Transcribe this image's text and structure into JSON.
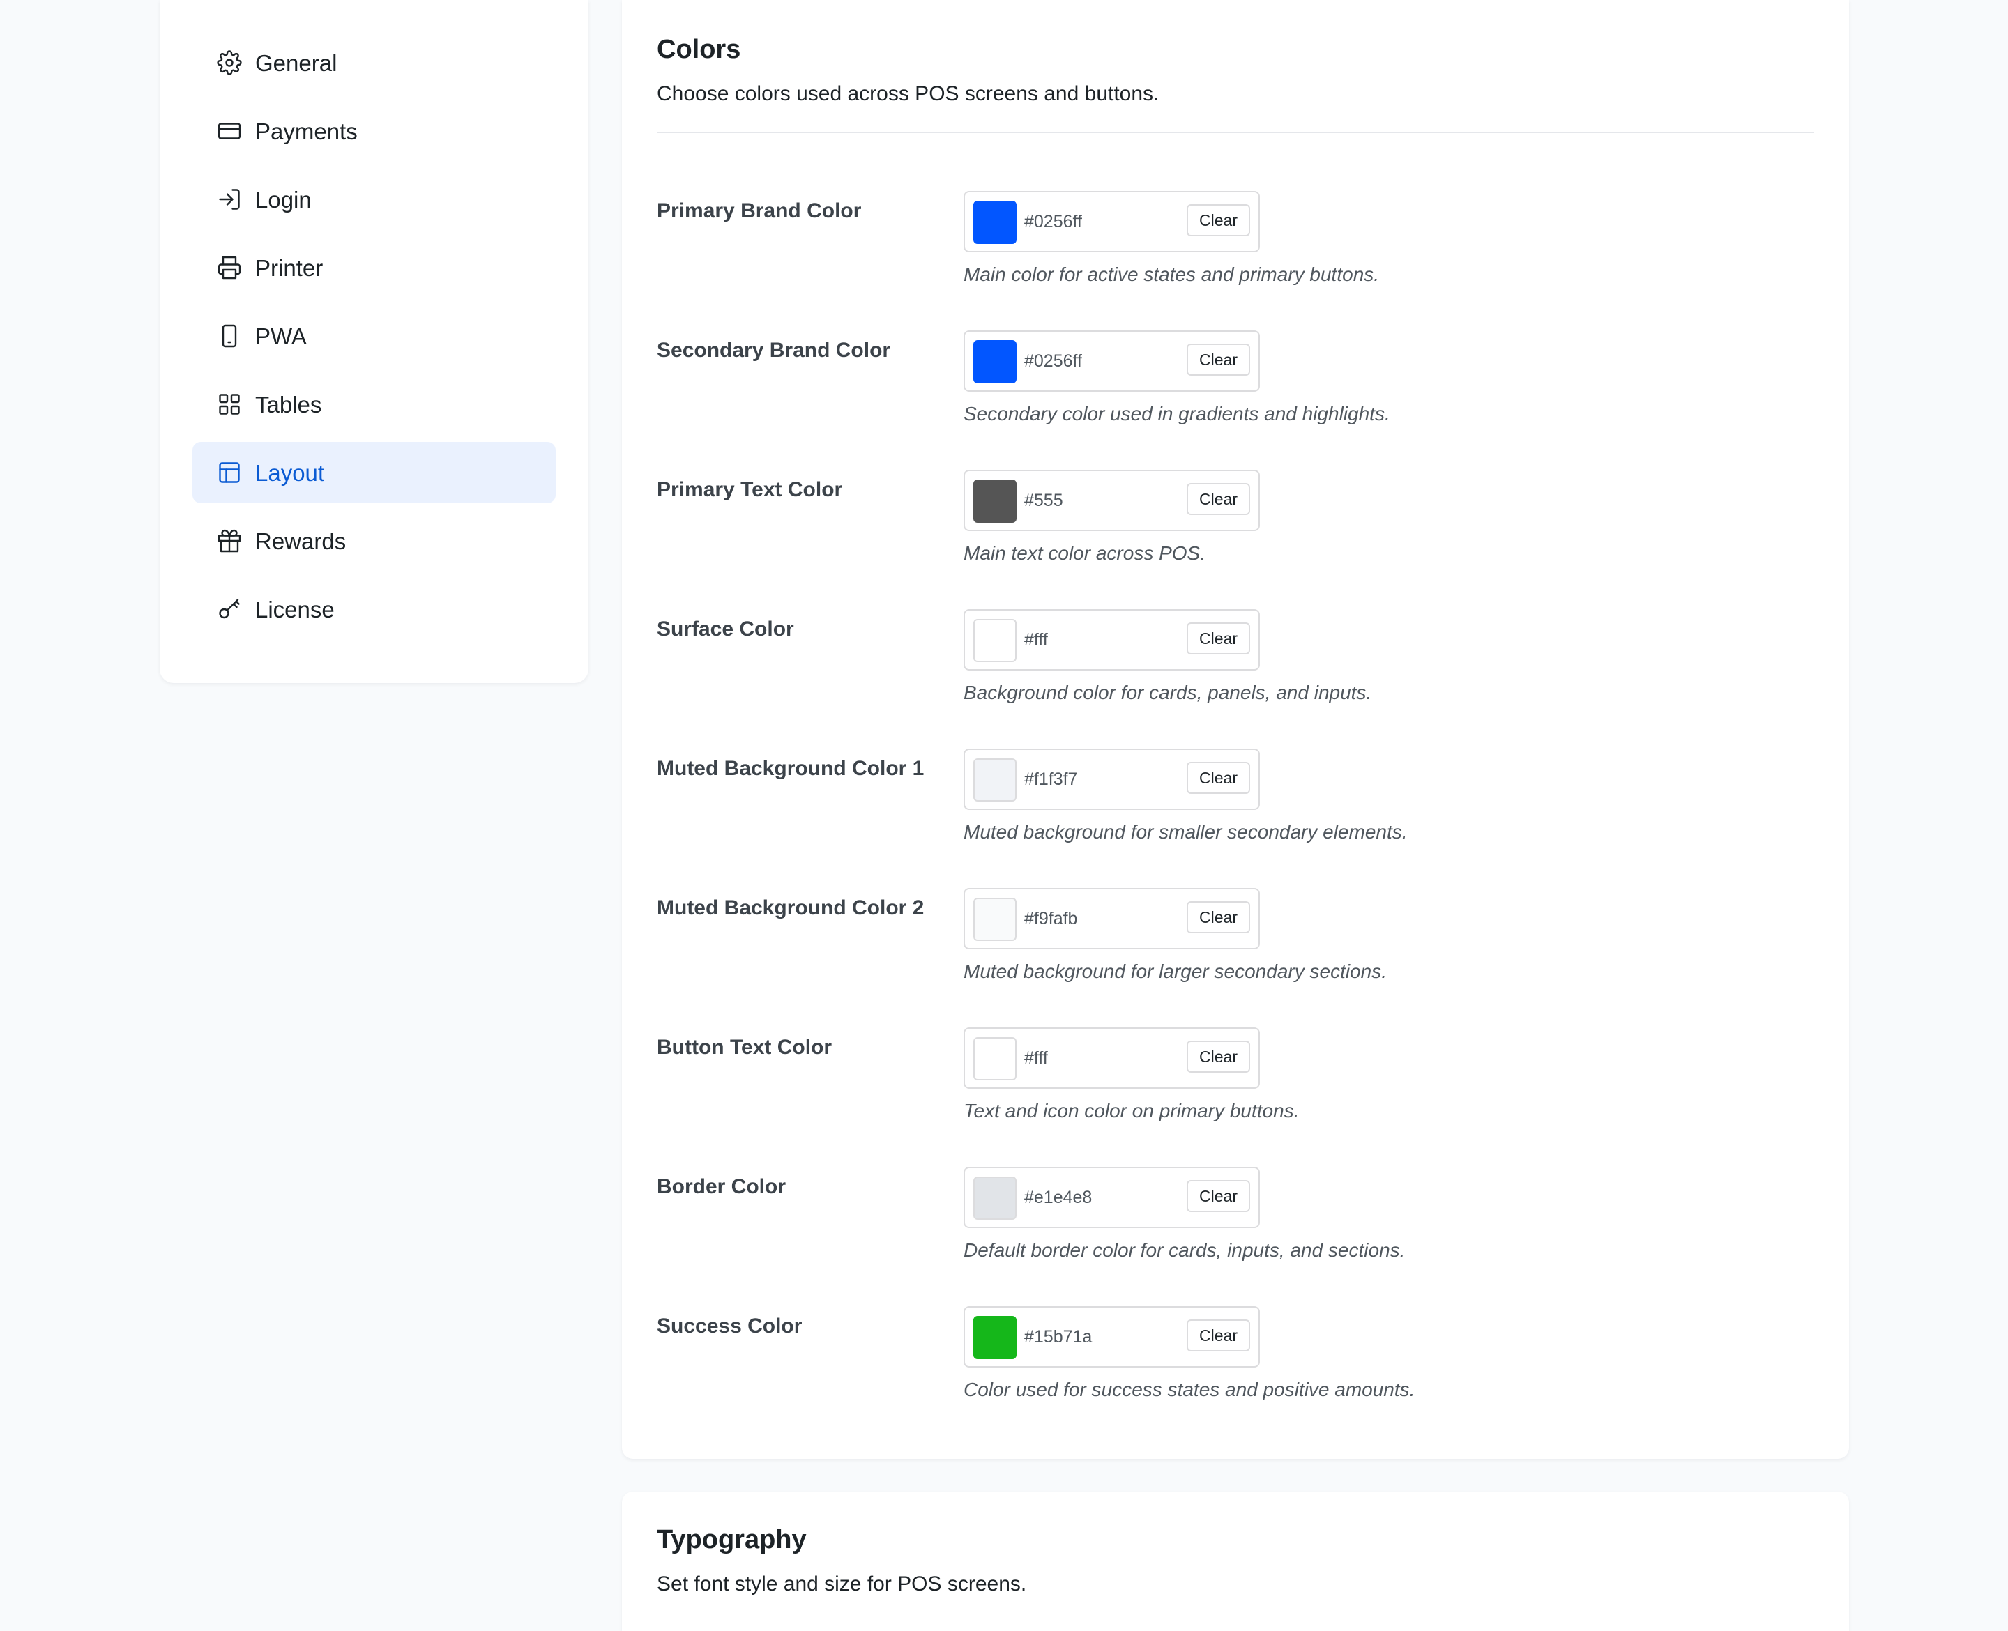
{
  "sidebar": {
    "items": [
      {
        "label": "General",
        "icon": "gear-icon"
      },
      {
        "label": "Payments",
        "icon": "credit-card-icon"
      },
      {
        "label": "Login",
        "icon": "login-icon"
      },
      {
        "label": "Printer",
        "icon": "printer-icon"
      },
      {
        "label": "PWA",
        "icon": "mobile-device-icon"
      },
      {
        "label": "Tables",
        "icon": "grid-icon"
      },
      {
        "label": "Layout",
        "icon": "layout-icon",
        "active": true
      },
      {
        "label": "Rewards",
        "icon": "gift-icon"
      },
      {
        "label": "License",
        "icon": "key-icon"
      }
    ]
  },
  "colors_section": {
    "title": "Colors",
    "subtitle": "Choose colors used across POS screens and buttons.",
    "clear_label": "Clear",
    "fields": [
      {
        "label": "Primary Brand Color",
        "value": "#0256ff",
        "swatch": "#0256ff",
        "help": "Main color for active states and primary buttons."
      },
      {
        "label": "Secondary Brand Color",
        "value": "#0256ff",
        "swatch": "#0256ff",
        "help": "Secondary color used in gradients and highlights."
      },
      {
        "label": "Primary Text Color",
        "value": "#555",
        "swatch": "#555555",
        "help": "Main text color across POS."
      },
      {
        "label": "Surface Color",
        "value": "#fff",
        "swatch": "#ffffff",
        "help": "Background color for cards, panels, and inputs."
      },
      {
        "label": "Muted Background Color 1",
        "value": "#f1f3f7",
        "swatch": "#f1f3f7",
        "help": "Muted background for smaller secondary elements."
      },
      {
        "label": "Muted Background Color 2",
        "value": "#f9fafb",
        "swatch": "#f9fafb",
        "help": "Muted background for larger secondary sections."
      },
      {
        "label": "Button Text Color",
        "value": "#fff",
        "swatch": "#ffffff",
        "help": "Text and icon color on primary buttons."
      },
      {
        "label": "Border Color",
        "value": "#e1e4e8",
        "swatch": "#e1e4e8",
        "help": "Default border color for cards, inputs, and sections."
      },
      {
        "label": "Success Color",
        "value": "#15b71a",
        "swatch": "#15b71a",
        "help": "Color used for success states and positive amounts."
      }
    ]
  },
  "typography_section": {
    "title": "Typography",
    "subtitle": "Set font style and size for POS screens."
  },
  "colors": {
    "accent": "#0b5bd3",
    "active_bg": "#eaf1fe",
    "page_bg": "#f8fafc"
  }
}
